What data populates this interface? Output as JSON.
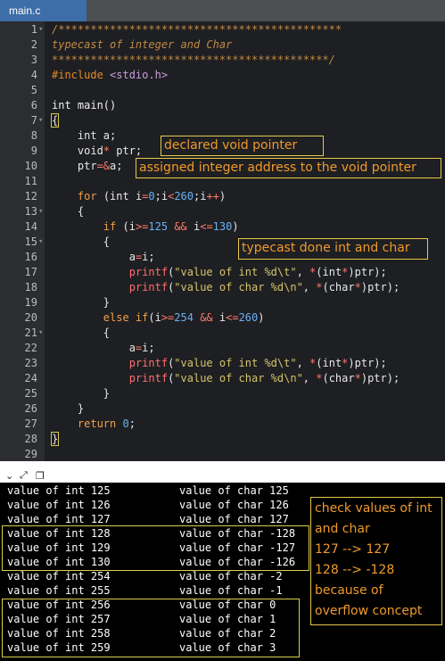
{
  "tab": {
    "title": "main.c"
  },
  "editor": {
    "lines": [
      {
        "n": "1",
        "fold": "-",
        "html": "<span class='c'>/********************************************</span>"
      },
      {
        "n": "2",
        "fold": "",
        "html": "<span class='c'>typecast of integer and Char</span>"
      },
      {
        "n": "3",
        "fold": "",
        "html": "<span class='c'>*******************************************/</span>"
      },
      {
        "n": "4",
        "fold": "",
        "html": "<span class='pp'>#include </span><span class='hdr'>&lt;stdio.h&gt;</span>"
      },
      {
        "n": "5",
        "fold": "",
        "html": ""
      },
      {
        "n": "6",
        "fold": "",
        "html": "<span class='k'>int main()</span>"
      },
      {
        "n": "7",
        "fold": "-",
        "html": "<span class='bracket'>{</span>"
      },
      {
        "n": "8",
        "fold": "",
        "html": "    int a;"
      },
      {
        "n": "9",
        "fold": "",
        "html": "    void<span class='o'>*</span> ptr;"
      },
      {
        "n": "10",
        "fold": "",
        "html": "    ptr<span class='o'>=&amp;</span>a;"
      },
      {
        "n": "11",
        "fold": "",
        "html": ""
      },
      {
        "n": "12",
        "fold": "",
        "html": "    <span class='ko'>for</span> (int i<span class='o'>=</span><span class='n'>0</span>;i<span class='o'>&lt;</span><span class='n'>260</span>;i<span class='o'>++</span>)"
      },
      {
        "n": "13",
        "fold": "-",
        "html": "    {"
      },
      {
        "n": "14",
        "fold": "",
        "html": "        <span class='ko'>if</span> (i<span class='o'>&gt;=</span><span class='n'>125</span> <span class='o'>&amp;&amp;</span> i<span class='o'>&lt;=</span><span class='n'>130</span>)"
      },
      {
        "n": "15",
        "fold": "-",
        "html": "        {"
      },
      {
        "n": "16",
        "fold": "",
        "html": "            a<span class='o'>=</span>i;"
      },
      {
        "n": "17",
        "fold": "",
        "html": "            <span class='f'>printf</span>(<span class='s'>\"value of int %d\\t\"</span>, <span class='o'>*</span>(int<span class='o'>*</span>)ptr);"
      },
      {
        "n": "18",
        "fold": "",
        "html": "            <span class='f'>printf</span>(<span class='s'>\"value of char %d\\n\"</span>, <span class='o'>*</span>(char<span class='o'>*</span>)ptr);"
      },
      {
        "n": "19",
        "fold": "",
        "html": "        }"
      },
      {
        "n": "20",
        "fold": "",
        "html": "        <span class='ko'>else if</span>(i<span class='o'>&gt;=</span><span class='n'>254</span> <span class='o'>&amp;&amp;</span> i<span class='o'>&lt;=</span><span class='n'>260</span>)"
      },
      {
        "n": "21",
        "fold": "-",
        "html": "        {"
      },
      {
        "n": "22",
        "fold": "",
        "html": "            a<span class='o'>=</span>i;"
      },
      {
        "n": "23",
        "fold": "",
        "html": "            <span class='f'>printf</span>(<span class='s'>\"value of int %d\\t\"</span>, <span class='o'>*</span>(int<span class='o'>*</span>)ptr);"
      },
      {
        "n": "24",
        "fold": "",
        "html": "            <span class='f'>printf</span>(<span class='s'>\"value of char %d\\n\"</span>, <span class='o'>*</span>(char<span class='o'>*</span>)ptr);"
      },
      {
        "n": "25",
        "fold": "",
        "html": "        }"
      },
      {
        "n": "26",
        "fold": "",
        "html": "    }"
      },
      {
        "n": "27",
        "fold": "",
        "html": "    <span class='ko'>return</span> <span class='n'>0</span>;"
      },
      {
        "n": "28",
        "fold": "",
        "html": "<span class='bracket'>}</span>"
      },
      {
        "n": "29",
        "fold": "",
        "html": ""
      }
    ]
  },
  "annotations": {
    "void_ptr": "declared void pointer",
    "assigned": "assigned integer address to the void pointer",
    "typecast": "typecast done int and char"
  },
  "terminal": {
    "rows": [
      [
        "value of int 125",
        "value of char 125"
      ],
      [
        "value of int 126",
        "value of char 126"
      ],
      [
        "value of int 127",
        "value of char 127"
      ],
      [
        "value of int 128",
        "value of char -128"
      ],
      [
        "value of int 129",
        "value of char -127"
      ],
      [
        "value of int 130",
        "value of char -126"
      ],
      [
        "value of int 254",
        "value of char -2"
      ],
      [
        "value of int 255",
        "value of char -1"
      ],
      [
        "value of int 256",
        "value of char 0"
      ],
      [
        "value of int 257",
        "value of char 1"
      ],
      [
        "value of int 258",
        "value of char 2"
      ],
      [
        "value of int 259",
        "value of char 3"
      ]
    ],
    "note": [
      "check values of int",
      "and char",
      " 127  --> 127",
      "128  --> -128",
      "because of",
      "overflow concept"
    ]
  }
}
